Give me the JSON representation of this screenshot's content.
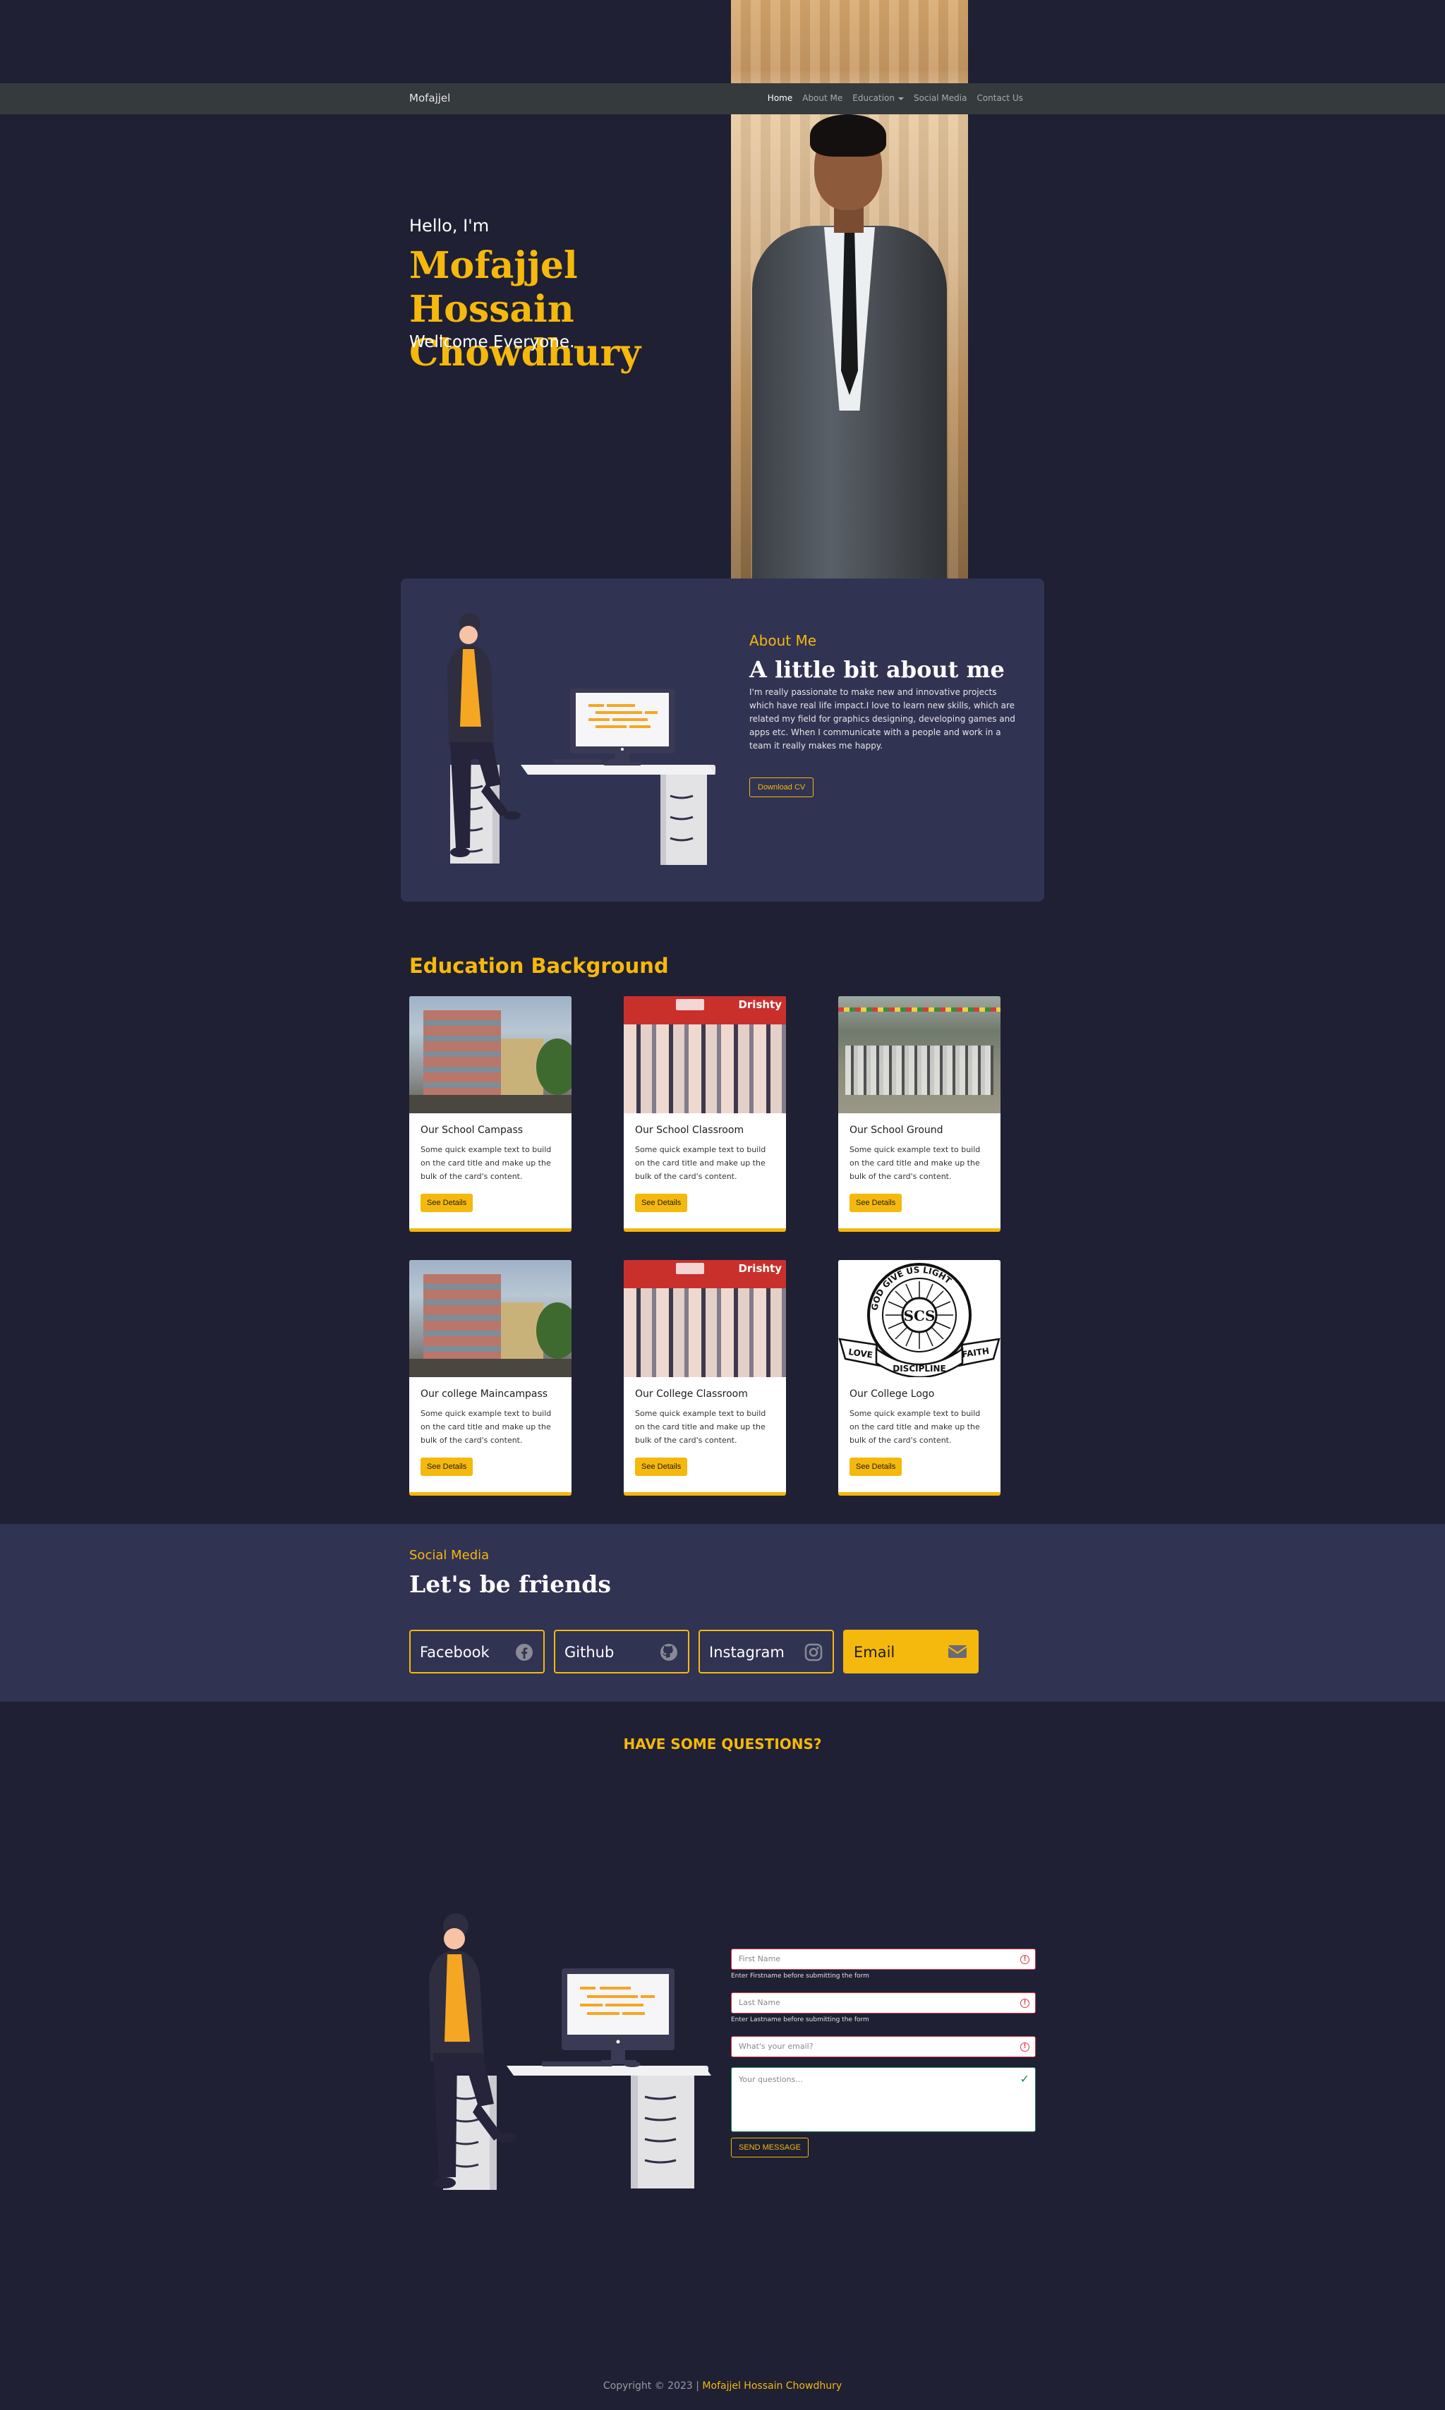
{
  "navbar": {
    "brand": "Mofajjel",
    "items": [
      {
        "label": "Home"
      },
      {
        "label": "About Me"
      },
      {
        "label": "Education"
      },
      {
        "label": "Social Media"
      },
      {
        "label": "Contact Us"
      }
    ]
  },
  "hero": {
    "greeting": "Hello, I'm",
    "name": "Mofajjel Hossain Chowdhury",
    "tagline": "Wellcome Everyone."
  },
  "about": {
    "eyebrow": "About Me",
    "title": "A little bit about me",
    "text": "I'm really passionate to make new and innovative projects which have real life impact.I love to learn new skills, which are related my field for graphics designing, developing games and apps etc. When I communicate with a people and work in a team it really makes me happy.",
    "button": "Download CV"
  },
  "education": {
    "title": "Education Background",
    "cards": [
      {
        "title": "Our School Campass",
        "text": "Some quick example text to build on the card title and make up the bulk of the card's content.",
        "button": "See Details"
      },
      {
        "title": "Our School Classroom",
        "text": "Some quick example text to build on the card title and make up the bulk of the card's content.",
        "button": "See Details",
        "banner": "Drishty"
      },
      {
        "title": "Our School Ground",
        "text": "Some quick example text to build on the card title and make up the bulk of the card's content.",
        "button": "See Details"
      },
      {
        "title": "Our college Maincampass",
        "text": "Some quick example text to build on the card title and make up the bulk of the card's content.",
        "button": "See Details"
      },
      {
        "title": "Our College Classroom",
        "text": "Some quick example text to build on the card title and make up the bulk of the card's content.",
        "button": "See Details",
        "banner": "Drishty"
      },
      {
        "title": "Our College Logo",
        "text": "Some quick example text to build on the card title and make up the bulk of the card's content.",
        "button": "See Details"
      }
    ],
    "logo_text": {
      "top": "GOD GIVE US LIGHT",
      "center": "SCS",
      "left": "LOVE",
      "right": "FAITH",
      "bottom": "DISCIPLINE"
    }
  },
  "social": {
    "eyebrow": "Social Media",
    "title": "Let's be friends",
    "buttons": [
      {
        "label": "Facebook",
        "icon": "facebook-icon"
      },
      {
        "label": "Github",
        "icon": "github-icon"
      },
      {
        "label": "Instagram",
        "icon": "instagram-icon"
      },
      {
        "label": "Email",
        "icon": "envelope-icon"
      }
    ]
  },
  "contact": {
    "title": "HAVE SOME QUESTIONS?",
    "first_name_placeholder": "First Name",
    "first_name_hint": "Enter Firstname before submitting the form",
    "last_name_placeholder": "Last Name",
    "last_name_hint": "Enter Lastname before submitting the form",
    "email_placeholder": "What's your email?",
    "questions_placeholder": "Your questions...",
    "send_button": "SEND MESSAGE"
  },
  "footer": {
    "prefix": "Copyright © 2023 |",
    "name": "Mofajjel Hossain Chowdhury"
  },
  "colors": {
    "accent": "#f5b80c",
    "background": "#1f2033",
    "panel": "#313352",
    "navbar": "#353a3d"
  }
}
